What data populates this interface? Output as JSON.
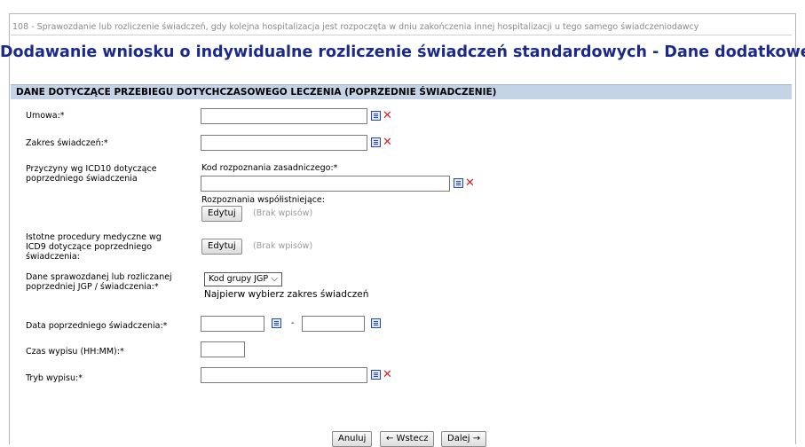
{
  "breadcrumb": "108 - Sprawozdanie lub rozliczenie świadczeń, gdy kolejna hospitalizacja jest rozpoczęta w dniu zakończenia innej hospitalizacji u tego samego świadczeniodawcy",
  "title": "Dodawanie wniosku o indywidualne rozliczenie świadczeń standardowych - Dane dodatkowe",
  "section_header": "DANE DOTYCZĄCE PRZEBIEGU DOTYCHCZASOWEGO LECZENIA (POPRZEDNIE ŚWIADCZENIE)",
  "fields": {
    "umowa": {
      "label": "Umowa:*",
      "value": ""
    },
    "zakres": {
      "label": "Zakres świadczeń:*",
      "value": ""
    },
    "icd10": {
      "label_line1": "Przyczyny wg ICD10 dotyczące",
      "label_line2": "poprzedniego świadczenia",
      "main_label": "Kod rozpoznania zasadniczego:*",
      "main_value": "",
      "coexisting_label": "Rozpoznania współistniejące:",
      "edit_button": "Edytuj",
      "empty_text": "(Brak wpisów)"
    },
    "icd9": {
      "label_line1": "Istotne procedury medyczne wg",
      "label_line2": "ICD9 dotyczące poprzedniego",
      "label_line3": "świadczenia:",
      "edit_button": "Edytuj",
      "empty_text": "(Brak wpisów)"
    },
    "jgp": {
      "label_line1": "Dane sprawozdanej lub rozliczanej",
      "label_line2": "poprzedniej JGP / świadczenia:*",
      "select_value": "Kod grupy JGP",
      "hint": "Najpierw wybierz zakres świadczeń"
    },
    "data": {
      "label": "Data poprzedniego świadczenia:*",
      "from": "",
      "separator": "-",
      "to": ""
    },
    "czas": {
      "label": "Czas wypisu (HH:MM):*",
      "value": ""
    },
    "tryb": {
      "label": "Tryb wypisu:*",
      "value": ""
    }
  },
  "footer": {
    "cancel": "Anuluj",
    "back": "← Wstecz",
    "next": "Dalej →"
  },
  "icons": {
    "list": "list-icon",
    "clear": "clear-x-icon",
    "calendar": "calendar-icon"
  }
}
